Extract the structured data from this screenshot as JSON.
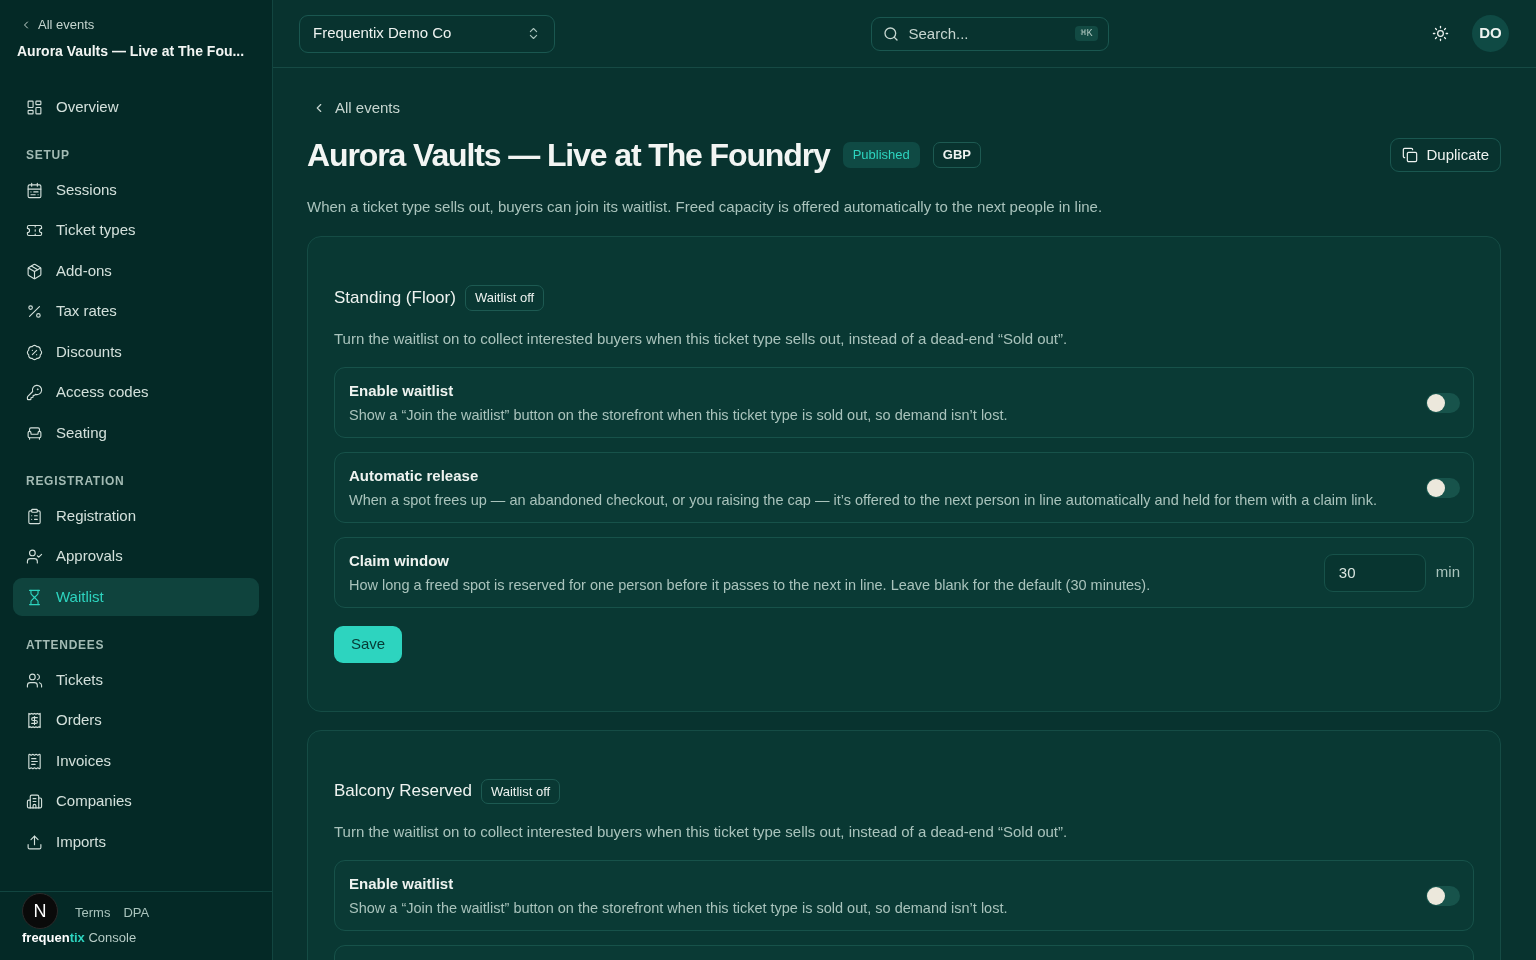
{
  "sidebar": {
    "back_link": "All events",
    "event_title": "Aurora Vaults — Live at The Fou...",
    "items": [
      {
        "label": "Overview",
        "selected": false
      }
    ],
    "sections": [
      {
        "title": "SETUP",
        "items": [
          {
            "label": "Sessions",
            "selected": false
          },
          {
            "label": "Ticket types",
            "selected": false
          },
          {
            "label": "Add-ons",
            "selected": false
          },
          {
            "label": "Tax rates",
            "selected": false
          },
          {
            "label": "Discounts",
            "selected": false
          },
          {
            "label": "Access codes",
            "selected": false
          },
          {
            "label": "Seating",
            "selected": false
          }
        ]
      },
      {
        "title": "REGISTRATION",
        "items": [
          {
            "label": "Registration",
            "selected": false
          },
          {
            "label": "Approvals",
            "selected": false
          },
          {
            "label": "Waitlist",
            "selected": true
          }
        ]
      },
      {
        "title": "ATTENDEES",
        "items": [
          {
            "label": "Tickets",
            "selected": false
          },
          {
            "label": "Orders",
            "selected": false
          },
          {
            "label": "Invoices",
            "selected": false
          },
          {
            "label": "Companies",
            "selected": false
          },
          {
            "label": "Imports",
            "selected": false
          }
        ]
      }
    ],
    "footer": {
      "links": [
        "Terms",
        "DPA"
      ],
      "brand": {
        "name_main": "frequen",
        "name_accent": "tix",
        "product": "Console"
      }
    },
    "dev_badge": "N"
  },
  "topbar": {
    "organization": "Frequentix Demo Co",
    "search": {
      "placeholder": "Search...",
      "shortcut": "⌘K"
    },
    "avatar": "DO"
  },
  "page": {
    "back_link": "All events",
    "title": "Aurora Vaults — Live at The Foundry",
    "badges": [
      {
        "label": "Published",
        "kind": "status"
      },
      {
        "label": "GBP",
        "kind": "outline"
      }
    ],
    "actions": [
      "Duplicate"
    ],
    "description": "When a ticket type sells out, buyers can join its waitlist. Freed capacity is offered automatically to the next people in line."
  },
  "ticket_types": [
    {
      "name": "Standing (Floor)",
      "status": "Waitlist off",
      "description": "Turn the waitlist on to collect interested buyers when this ticket type sells out, instead of a dead-end “Sold out”.",
      "settings": [
        {
          "kind": "toggle",
          "title": "Enable waitlist",
          "description": "Show a “Join the waitlist” button on the storefront when this ticket type is sold out, so demand isn’t lost.",
          "on": false
        },
        {
          "kind": "toggle",
          "title": "Automatic release",
          "description": "When a spot frees up — an abandoned checkout, or you raising the cap — it’s offered to the next person in line automatically and held for them with a claim link.",
          "on": false
        },
        {
          "kind": "number",
          "title": "Claim window",
          "description": "How long a freed spot is reserved for one person before it passes to the next in line. Leave blank for the default (30 minutes).",
          "value": "30",
          "unit": "min"
        }
      ],
      "save": "Save"
    },
    {
      "name": "Balcony Reserved",
      "status": "Waitlist off",
      "description": "Turn the waitlist on to collect interested buyers when this ticket type sells out, instead of a dead-end “Sold out”.",
      "settings": [
        {
          "kind": "toggle",
          "title": "Enable waitlist",
          "description": "Show a “Join the waitlist” button on the storefront when this ticket type is sold out, so demand isn’t lost.",
          "on": false
        }
      ],
      "more_below": true
    }
  ]
}
